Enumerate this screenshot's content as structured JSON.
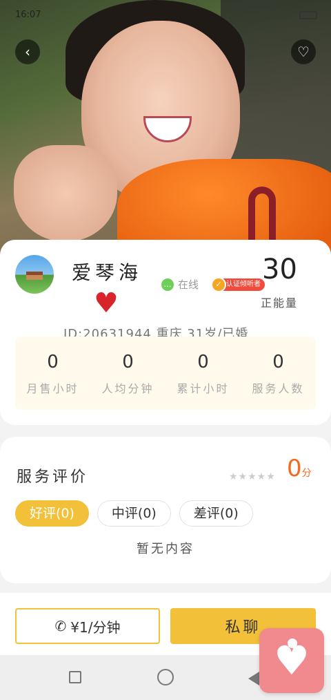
{
  "status_bar": {
    "time": "16:07"
  },
  "header": {
    "back_icon": "chevron-left-icon",
    "favorite_icon": "heart-outline-icon"
  },
  "profile": {
    "name": "爱琴海",
    "online_label": "在线",
    "cert_label": "认证倾听者",
    "energy_value": "30",
    "energy_label": "正能量",
    "id_line": "ID:20631944  重庆 31岁/已婚",
    "heart_icon": "heart-icon"
  },
  "stats": [
    {
      "value": "0",
      "label": "月售小时"
    },
    {
      "value": "0",
      "label": "人均分钟"
    },
    {
      "value": "0",
      "label": "累计小时"
    },
    {
      "value": "0",
      "label": "服务人数"
    }
  ],
  "reviews": {
    "title": "服务评价",
    "stars": "★★★★★",
    "score": "0",
    "score_unit": "分",
    "tabs": [
      {
        "label": "好评(0)",
        "active": true
      },
      {
        "label": "中评(0)",
        "active": false
      },
      {
        "label": "差评(0)",
        "active": false
      }
    ],
    "empty_text": "暂无内容"
  },
  "actions": {
    "call_label": "¥1/分钟",
    "chat_label": "私聊"
  },
  "colors": {
    "accent": "#f3c03a",
    "score": "#f46a1f",
    "cert": "#f04b3c"
  }
}
